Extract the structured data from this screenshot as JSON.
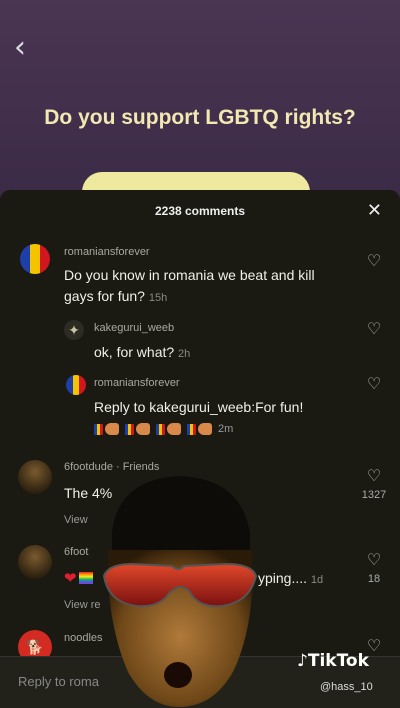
{
  "question": "Do you support LGBTQ rights?",
  "sheet": {
    "title": "2238 comments",
    "close_icon": "close-icon"
  },
  "comments": [
    {
      "user": "romaniansforever",
      "text": "Do you know in romania we beat and kill gays for fun?",
      "time": "15h",
      "avatar": "romania-flag"
    },
    {
      "user": "kakegurui_weeb",
      "text": "ok, for what?",
      "time": "2h",
      "avatar": "anime-avatar"
    },
    {
      "user": "romaniansforever",
      "text": "Reply to kakegurui_weeb:For fun!",
      "time": "2m",
      "avatar": "romania-flag"
    },
    {
      "user": "6footdude · Friends",
      "text": "The 4%",
      "likes": "1327",
      "view": "View",
      "avatar": "person-avatar"
    },
    {
      "user": "6foot",
      "text": "yping....",
      "time": "1d",
      "likes": "18",
      "view": "View re",
      "avatar": "person-avatar"
    },
    {
      "user": "noodles",
      "avatar": "dog-avatar"
    }
  ],
  "reply_placeholder": "Reply to roma",
  "watermark": {
    "brand": "TikTok",
    "handle": "@hass_10"
  },
  "colors": {
    "romania_blue": "#1f3fa8",
    "romania_yellow": "#f5c400",
    "romania_red": "#d0161e",
    "option_fill": "#efe9a0"
  }
}
